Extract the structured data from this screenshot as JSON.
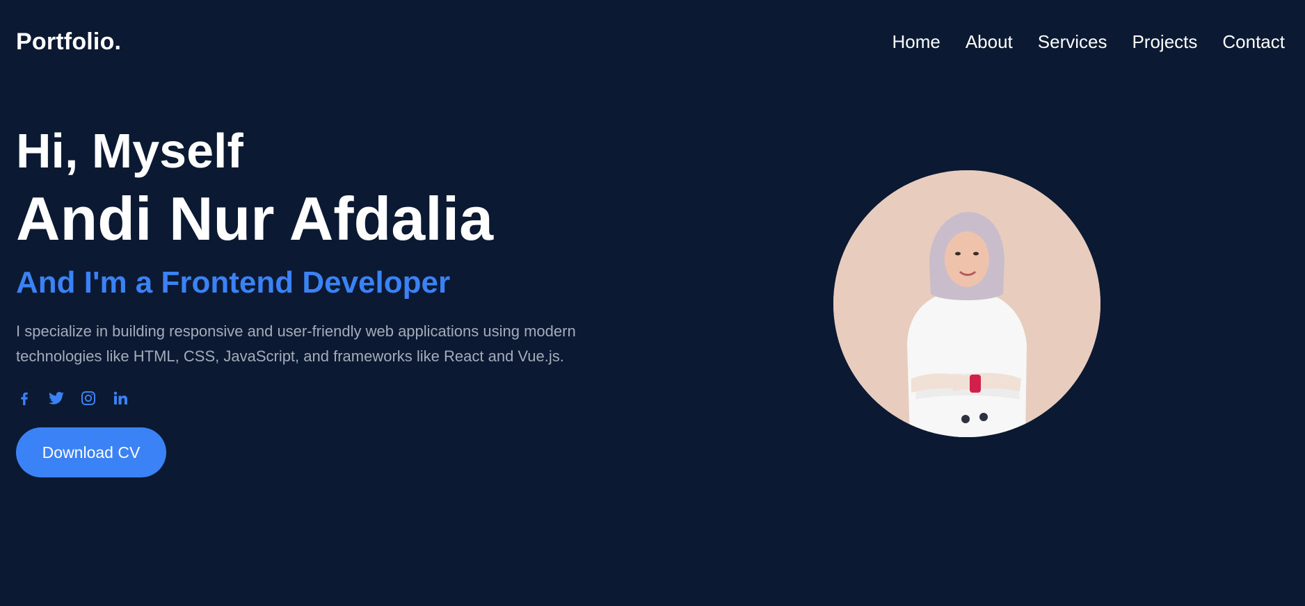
{
  "header": {
    "logo": "Portfolio.",
    "nav": [
      "Home",
      "About",
      "Services",
      "Projects",
      "Contact"
    ]
  },
  "hero": {
    "greeting": "Hi, Myself",
    "name": "Andi Nur Afdalia",
    "role_prefix": "And I'm a ",
    "role_highlight": "Frontend Developer",
    "description": "I specialize in building responsive and user-friendly web applications using modern technologies like HTML, CSS, JavaScript, and frameworks like React and Vue.js.",
    "socials": [
      "facebook-icon",
      "twitter-icon",
      "instagram-icon",
      "linkedin-icon"
    ],
    "cta_label": "Download CV"
  },
  "colors": {
    "background": "#0b1932",
    "accent": "#3b82f6",
    "muted_text": "#a4acbb"
  }
}
